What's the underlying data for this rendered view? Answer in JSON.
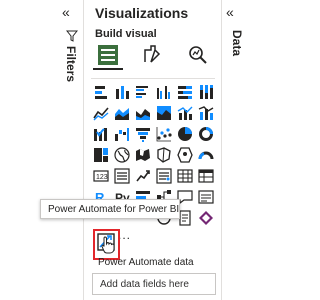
{
  "filters": {
    "label": "Filters",
    "collapse_icon": "double-chevron-left-icon",
    "filter_icon": "funnel-icon"
  },
  "visualizations": {
    "title": "Visualizations",
    "expand_icon": "double-chevron-right-icon",
    "build_visual_label": "Build visual",
    "modes": [
      "build-visual-icon",
      "format-visual-icon",
      "analytics-icon"
    ],
    "more_label": "...",
    "section_title": "Power Automate data",
    "field_placeholder": "Add data fields here"
  },
  "tooltip": {
    "text": "Power Automate for Power BI"
  },
  "data": {
    "label": "Data",
    "collapse_icon": "double-chevron-left-icon"
  },
  "colors": {
    "accent": "#118dff",
    "selection_red": "#e2262b",
    "icon_dark": "#252423"
  }
}
